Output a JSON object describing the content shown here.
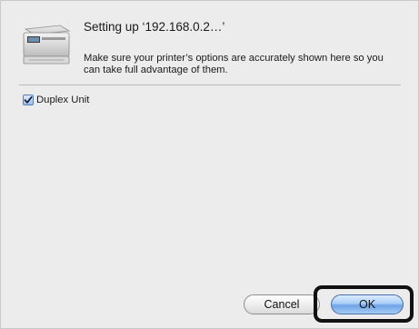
{
  "dialog": {
    "title": "Setting up ‘192.168.0.2…’",
    "message": "Make sure your printer’s options are accurately shown here so you can take full advantage of them.",
    "printer_icon": "printer-icon"
  },
  "options": [
    {
      "label": "Duplex Unit",
      "checked": true
    }
  ],
  "buttons": {
    "cancel_label": "Cancel",
    "ok_label": "OK"
  },
  "colors": {
    "ok_button": "#8fbaf0",
    "highlight_ring": "#111111",
    "sheet_background": "#ececec"
  }
}
